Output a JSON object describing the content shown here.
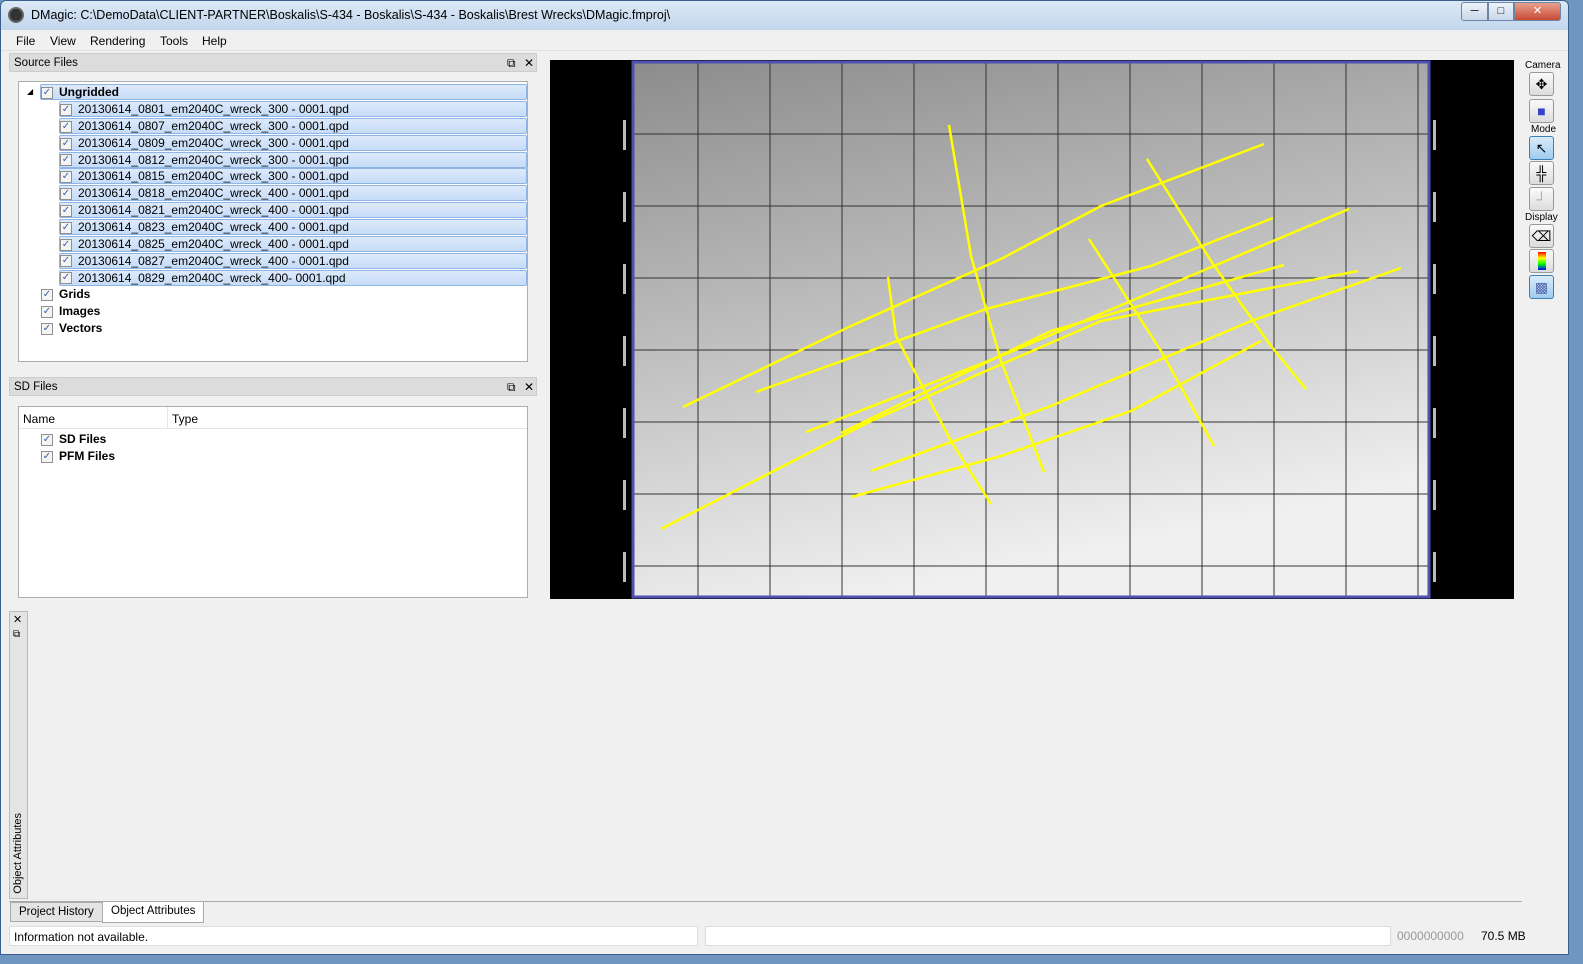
{
  "window": {
    "title": "DMagic: C:\\DemoData\\CLIENT-PARTNER\\Boskalis\\S-434 - Boskalis\\S-434 - Boskalis\\Brest Wrecks\\DMagic.fmproj\\",
    "minimize": "─",
    "maximize": "□",
    "close": "✕"
  },
  "menu": [
    "File",
    "View",
    "Rendering",
    "Tools",
    "Help"
  ],
  "source_files": {
    "title": "Source Files",
    "root": "Ungridded",
    "files": [
      "20130614_0801_em2040C_wreck_300 - 0001.qpd",
      "20130614_0807_em2040C_wreck_300 - 0001.qpd",
      "20130614_0809_em2040C_wreck_300 - 0001.qpd",
      "20130614_0812_em2040C_wreck_300 - 0001.qpd",
      "20130614_0815_em2040C_wreck_300 - 0001.qpd",
      "20130614_0818_em2040C_wreck_400 - 0001.qpd",
      "20130614_0821_em2040C_wreck_400 - 0001.qpd",
      "20130614_0823_em2040C_wreck_400 - 0001.qpd",
      "20130614_0825_em2040C_wreck_400 - 0001.qpd",
      "20130614_0827_em2040C_wreck_400 - 0001.qpd",
      "20130614_0829_em2040C_wreck_400- 0001.qpd"
    ],
    "groups": [
      "Grids",
      "Images",
      "Vectors"
    ]
  },
  "sd_files": {
    "title": "SD Files",
    "columns": [
      "Name",
      "Type"
    ],
    "items": [
      "SD Files",
      "PFM Files"
    ]
  },
  "side_dock": {
    "label": "Object Attributes"
  },
  "toolbar": {
    "camera": "Camera",
    "mode": "Mode",
    "display": "Display"
  },
  "bottom_tabs": [
    "Project History",
    "Object Attributes"
  ],
  "status": {
    "message": "Information not available.",
    "counter": "0000000000",
    "memory": "70.5 MB"
  },
  "colors": {
    "track": "#ffff00",
    "frame": "#5050b0",
    "selection": "#c6dcf7"
  }
}
